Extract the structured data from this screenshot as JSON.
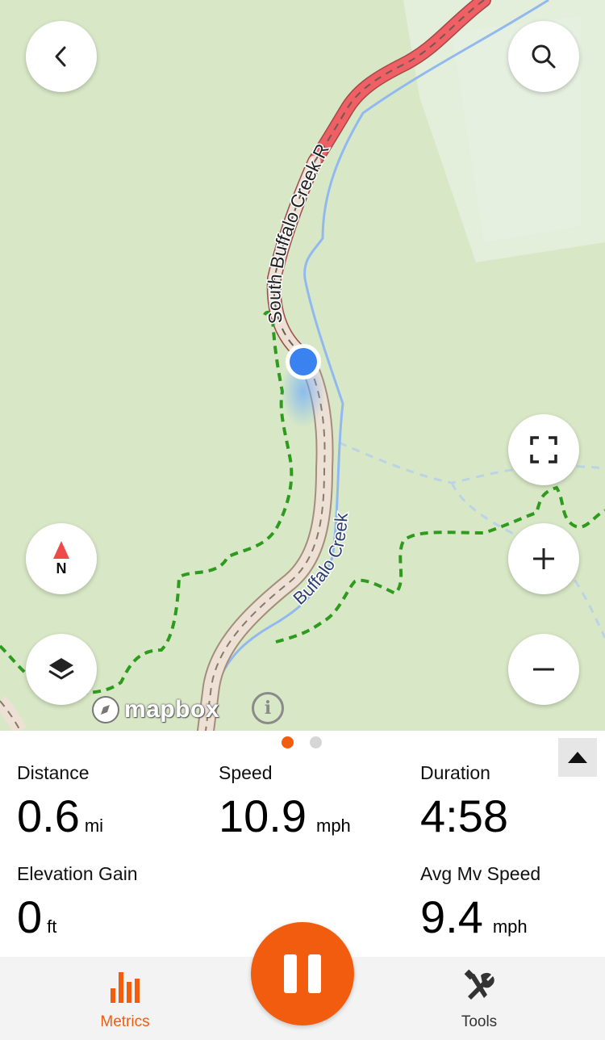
{
  "map": {
    "road_label": "South Buffalo Creek Road",
    "creek_label": "Buffalo Creek",
    "attribution": "mapbox",
    "compass_letter": "N",
    "icons": {
      "back": "chevron-left-icon",
      "search": "search-icon",
      "fullscreen": "fullscreen-icon",
      "compass": "compass-icon",
      "zoom_in": "plus-icon",
      "zoom_out": "minus-icon",
      "layers": "layers-icon",
      "info": "info-icon"
    },
    "colors": {
      "land": "#d8e8c6",
      "road_highlight": "#ef5f63",
      "road": "#e8dccf",
      "creek": "#8fb7f0",
      "trail": "#3a9a2a",
      "location": "#3a82f0"
    }
  },
  "pager": {
    "pages": 2,
    "active": 0,
    "active_color": "#f25c0f",
    "inactive_color": "#d6d6d6"
  },
  "metrics": {
    "distance": {
      "label": "Distance",
      "value": "0.6",
      "unit": "mi"
    },
    "speed": {
      "label": "Speed",
      "value": "10.9",
      "unit": "mph"
    },
    "duration": {
      "label": "Duration",
      "value": "4:58"
    },
    "elevation_gain": {
      "label": "Elevation Gain",
      "value": "0",
      "unit": "ft"
    },
    "avg_mv_speed": {
      "label": "Avg Mv Speed",
      "value": "9.4",
      "unit": "mph"
    }
  },
  "tabbar": {
    "metrics_label": "Metrics",
    "tools_label": "Tools",
    "active_color": "#f25c0f",
    "inactive_color": "#333333"
  }
}
